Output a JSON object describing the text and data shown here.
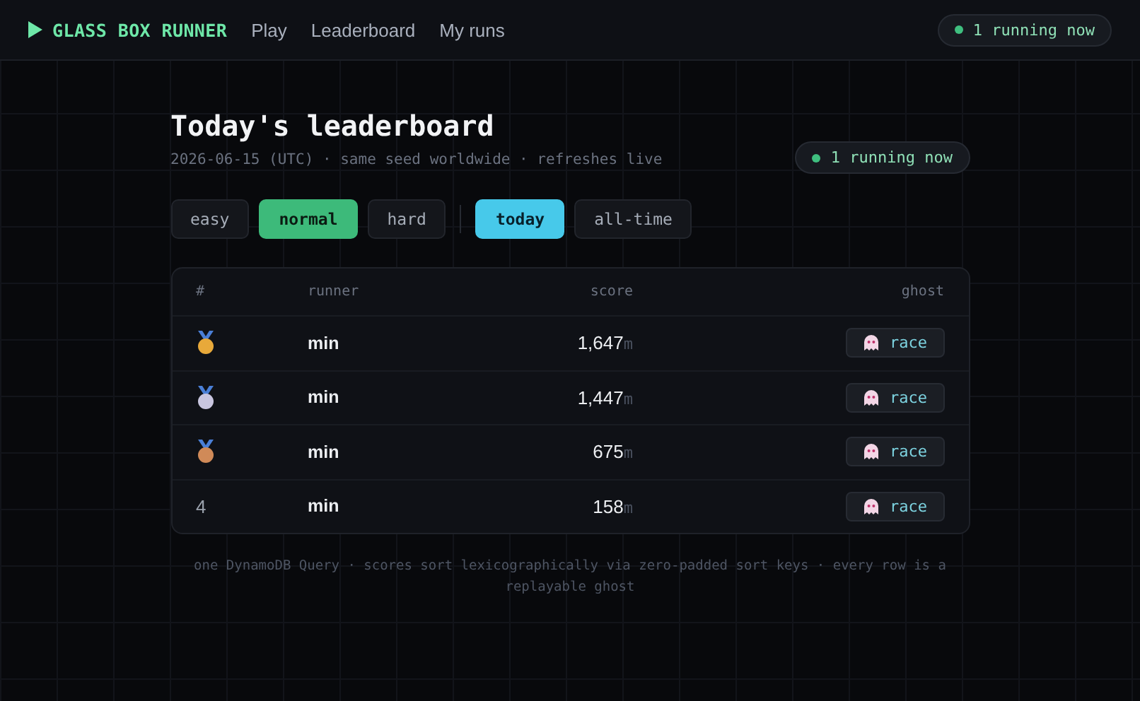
{
  "nav": {
    "brand": "GLASS BOX RUNNER",
    "links": [
      {
        "label": "Play"
      },
      {
        "label": "Leaderboard"
      },
      {
        "label": "My runs"
      }
    ],
    "status": "1 running now"
  },
  "header": {
    "title": "Today's leaderboard",
    "subtitle": "2026-06-15 (UTC) · same seed worldwide · refreshes live",
    "status": "1 running now"
  },
  "difficulty": [
    {
      "label": "easy",
      "selected": false
    },
    {
      "label": "normal",
      "selected": true
    },
    {
      "label": "hard",
      "selected": false
    }
  ],
  "period": [
    {
      "label": "today",
      "selected": true
    },
    {
      "label": "all-time",
      "selected": false
    }
  ],
  "table": {
    "columns": [
      "#",
      "runner",
      "score",
      "ghost"
    ],
    "rows": [
      {
        "kind": "medal",
        "color": "#e8a93a",
        "runner": "min",
        "score": "1,647",
        "unit": "m",
        "action": "race"
      },
      {
        "kind": "medal",
        "color": "#c9c6e0",
        "runner": "min",
        "score": "1,447",
        "unit": "m",
        "action": "race"
      },
      {
        "kind": "medal",
        "color": "#d08a58",
        "runner": "min",
        "score": "675",
        "unit": "m",
        "action": "race"
      },
      {
        "kind": "number",
        "rank": "4",
        "runner": "min",
        "score": "158",
        "unit": "m",
        "action": "race"
      }
    ]
  },
  "footnote": "one DynamoDB Query · scores sort lexicographically via zero-padded sort keys · every row is a replayable ghost"
}
